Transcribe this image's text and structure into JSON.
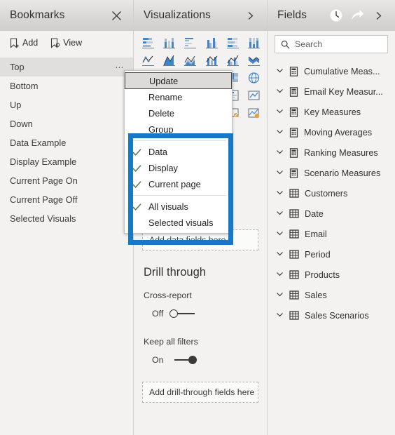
{
  "bookmarks_panel": {
    "title": "Bookmarks",
    "close_icon": "close-icon",
    "toolbar": [
      {
        "label": "Add",
        "icon": "add-bookmark-icon"
      },
      {
        "label": "View",
        "icon": "view-bookmark-icon"
      }
    ],
    "items": [
      {
        "label": "Top",
        "selected": true,
        "ellipsis": "⋯"
      },
      {
        "label": "Bottom",
        "selected": false
      },
      {
        "label": "Up",
        "selected": false
      },
      {
        "label": "Down",
        "selected": false
      },
      {
        "label": "Data Example",
        "selected": false
      },
      {
        "label": "Display Example",
        "selected": false
      },
      {
        "label": "Current Page On",
        "selected": false
      },
      {
        "label": "Current Page Off",
        "selected": false
      },
      {
        "label": "Selected Visuals",
        "selected": false
      }
    ]
  },
  "context_menu": {
    "items": [
      {
        "label": "Update",
        "checked": false,
        "highlighted": true
      },
      {
        "label": "Rename",
        "checked": false,
        "highlighted": false
      },
      {
        "label": "Delete",
        "checked": false,
        "highlighted": false
      },
      {
        "label": "Group",
        "checked": false,
        "highlighted": false
      },
      {
        "label": "Data",
        "checked": true,
        "highlighted": false
      },
      {
        "label": "Display",
        "checked": true,
        "highlighted": false
      },
      {
        "label": "Current page",
        "checked": true,
        "highlighted": false
      },
      {
        "label": "All visuals",
        "checked": true,
        "highlighted": false
      },
      {
        "label": "Selected visuals",
        "checked": false,
        "highlighted": false
      }
    ],
    "check_color": "#4a7a4a",
    "highlight_color": "#dcdbda"
  },
  "highlight_box": {
    "color": "#1878c8",
    "name": "blue-annotation-box"
  },
  "visualizations_panel": {
    "title": "Visualizations",
    "expand_icon": "chevron-right-icon",
    "icons_row1": [
      "stacked-bar-chart-icon",
      "stacked-column-chart-icon",
      "clustered-bar-chart-icon",
      "clustered-column-chart-icon",
      "hundred-stacked-bar-icon",
      "hundred-stacked-column-icon"
    ],
    "icons_row2": [
      "line-chart-icon",
      "area-chart-icon",
      "stacked-area-chart-icon",
      "line-stacked-column-icon",
      "line-clustered-column-icon",
      "ribbon-chart-icon"
    ],
    "icons_row3": [
      "waterfall-chart-icon",
      "scatter-chart-icon",
      "pie-chart-icon",
      "donut-chart-icon",
      "treemap-icon",
      "map-icon"
    ],
    "icons_row4": [
      "filled-map-icon",
      "funnel-chart-icon",
      "gauge-icon",
      "card-icon",
      "multi-row-card-icon",
      "kpi-icon"
    ],
    "icons_row5": [
      "slicer-icon",
      "table-icon",
      "matrix-icon",
      "r-script-icon",
      "python-visual-icon",
      "get-more-visuals-icon"
    ],
    "drop_zone_label": "Add data fields here",
    "drill_through": {
      "title": "Drill through",
      "cross_report": {
        "label": "Cross-report",
        "state": "Off"
      },
      "keep_all_filters": {
        "label": "Keep all filters",
        "state": "On"
      },
      "drop_zone_label": "Add drill-through fields here"
    }
  },
  "fields_panel": {
    "title": "Fields",
    "clock_icon": "clock-icon",
    "redo_icon": "redo-arrow-icon",
    "expand_icon": "chevron-right-icon",
    "search": {
      "placeholder": "Search",
      "icon": "search-icon",
      "value": ""
    },
    "items": [
      {
        "label": "Cumulative Meas...",
        "type": "measure-table"
      },
      {
        "label": "Email Key Measur...",
        "type": "measure-table"
      },
      {
        "label": "Key Measures",
        "type": "measure-table"
      },
      {
        "label": "Moving Averages",
        "type": "measure-table"
      },
      {
        "label": "Ranking Measures",
        "type": "measure-table"
      },
      {
        "label": "Scenario Measures",
        "type": "measure-table"
      },
      {
        "label": "Customers",
        "type": "table"
      },
      {
        "label": "Date",
        "type": "table"
      },
      {
        "label": "Email",
        "type": "table"
      },
      {
        "label": "Period",
        "type": "table"
      },
      {
        "label": "Products",
        "type": "table"
      },
      {
        "label": "Sales",
        "type": "table"
      },
      {
        "label": "Sales Scenarios",
        "type": "table"
      }
    ]
  }
}
